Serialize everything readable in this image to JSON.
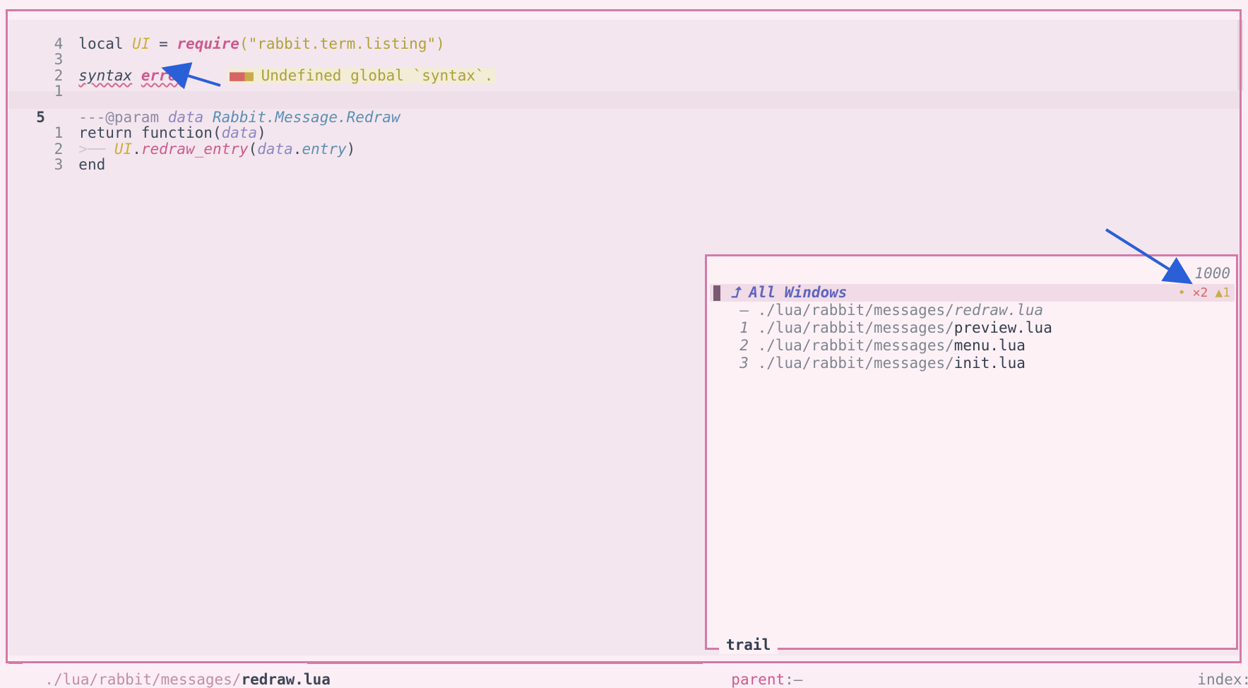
{
  "editor": {
    "lines": [
      {
        "num": "4",
        "parts": [
          "local",
          "UI",
          "=",
          "require",
          "(\"rabbit.term.listing\")"
        ]
      },
      {
        "num": "3"
      },
      {
        "num": "2",
        "parts": [
          "syntax",
          "error"
        ],
        "diagnostic": "Undefined global `syntax`.",
        "diagnostic_squares": "■■",
        "diagnostic_square_warn": "■"
      },
      {
        "num": "1"
      },
      {
        "num": "5",
        "parts": [
          "---@param",
          "data",
          "Rabbit.Message.Redraw"
        ]
      },
      {
        "num": "1",
        "parts": [
          "return function(",
          "data",
          ")"
        ]
      },
      {
        "num": "2",
        "guide": ">──",
        "parts": [
          "UI",
          ".",
          "redraw_entry",
          "(",
          "data",
          ".",
          "entry",
          ")"
        ]
      },
      {
        "num": "3",
        "parts": [
          "end"
        ]
      }
    ]
  },
  "floating": {
    "header_icon": "⮥",
    "header_title": "All Windows",
    "count": "1000",
    "entries": [
      {
        "index": "–",
        "dir": "./lua/rabbit/messages/",
        "file": "redraw.lua",
        "selected": true
      },
      {
        "index": "1",
        "dir": "./lua/rabbit/messages/",
        "file": "preview.lua"
      },
      {
        "index": "2",
        "dir": "./lua/rabbit/messages/",
        "file": "menu.lua"
      },
      {
        "index": "3",
        "dir": "./lua/rabbit/messages/",
        "file": "init.lua"
      }
    ],
    "badges": {
      "dot": "•",
      "errors": "✕2",
      "warnings": "▲1"
    },
    "footer_title": "trail"
  },
  "statusbar": {
    "file_dir": "./lua/rabbit/messages/",
    "file_name": "redraw.lua",
    "parent": "parent",
    "parent_value": ":–",
    "index": "index:?"
  },
  "colors": {
    "border": "#d47aa8",
    "annotation_arrow": "#2a5fd8",
    "error": "#d86565",
    "warning": "#c9ac4a"
  }
}
